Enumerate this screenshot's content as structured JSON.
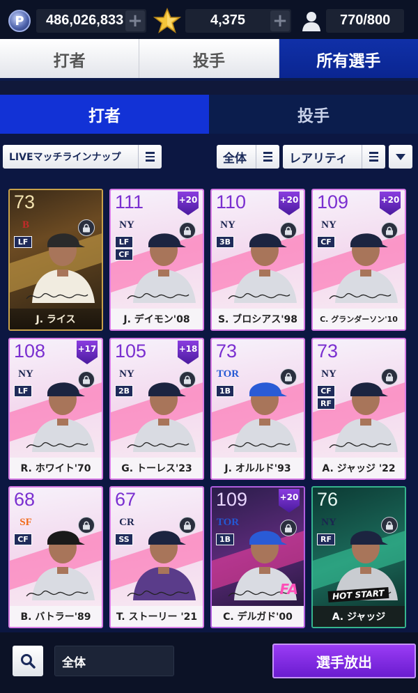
{
  "status": {
    "coins_icon": "p-coin-icon",
    "coins": "486,026,833",
    "stars_icon": "star-icon",
    "stars": "4,375",
    "roster_icon": "player-silhouette-icon",
    "roster": "770/800"
  },
  "main_tabs": [
    {
      "label": "打者",
      "active": false
    },
    {
      "label": "投手",
      "active": false
    },
    {
      "label": "所有選手",
      "active": true
    }
  ],
  "sub_tabs": [
    {
      "label": "打者",
      "active": true
    },
    {
      "label": "投手",
      "active": false
    }
  ],
  "filters": {
    "lineup": "LIVEマッチラインナップ",
    "scope": "全体",
    "sort": "レアリティ"
  },
  "cards": [
    {
      "ovr": "73",
      "team": "B",
      "positions": [
        "LF"
      ],
      "boost": "",
      "name": "J. ライス",
      "style": "legend"
    },
    {
      "ovr": "111",
      "team": "NY",
      "positions": [
        "LF",
        "CF"
      ],
      "boost": "+20",
      "name": "J. デイモン'08",
      "style": "pink"
    },
    {
      "ovr": "110",
      "team": "NY",
      "positions": [
        "3B"
      ],
      "boost": "+20",
      "name": "S. ブロシアス'98",
      "style": "pink"
    },
    {
      "ovr": "109",
      "team": "NY",
      "positions": [
        "CF"
      ],
      "boost": "+20",
      "name": "C. グランダーソン'10",
      "style": "pink"
    },
    {
      "ovr": "108",
      "team": "NY",
      "positions": [
        "LF"
      ],
      "boost": "+17",
      "name": "R. ホワイト'70",
      "style": "pink"
    },
    {
      "ovr": "105",
      "team": "NY",
      "positions": [
        "2B"
      ],
      "boost": "+18",
      "name": "G. トーレス'23",
      "style": "pink"
    },
    {
      "ovr": "73",
      "team": "TOR",
      "positions": [
        "1B"
      ],
      "boost": "",
      "name": "J. オルルド'93",
      "style": "pink"
    },
    {
      "ovr": "73",
      "team": "NY",
      "positions": [
        "CF",
        "RF"
      ],
      "boost": "",
      "name": "A. ジャッジ '22",
      "style": "pink"
    },
    {
      "ovr": "68",
      "team": "SF",
      "positions": [
        "CF"
      ],
      "boost": "",
      "name": "B. バトラー'89",
      "style": "pink"
    },
    {
      "ovr": "67",
      "team": "CR",
      "positions": [
        "SS"
      ],
      "boost": "",
      "name": "T. ストーリー '21",
      "style": "pink"
    },
    {
      "ovr": "109",
      "team": "TOR",
      "positions": [
        "1B"
      ],
      "boost": "+20",
      "name": "C. デルガド'00",
      "style": "dark",
      "extra": "FA"
    },
    {
      "ovr": "76",
      "team": "NY",
      "positions": [
        "RF"
      ],
      "boost": "",
      "name": "A. ジャッジ",
      "style": "green",
      "extra": "HOT START"
    }
  ],
  "bottom": {
    "search_icon": "magnifier-icon",
    "search_value": "全体",
    "release_label": "選手放出"
  }
}
